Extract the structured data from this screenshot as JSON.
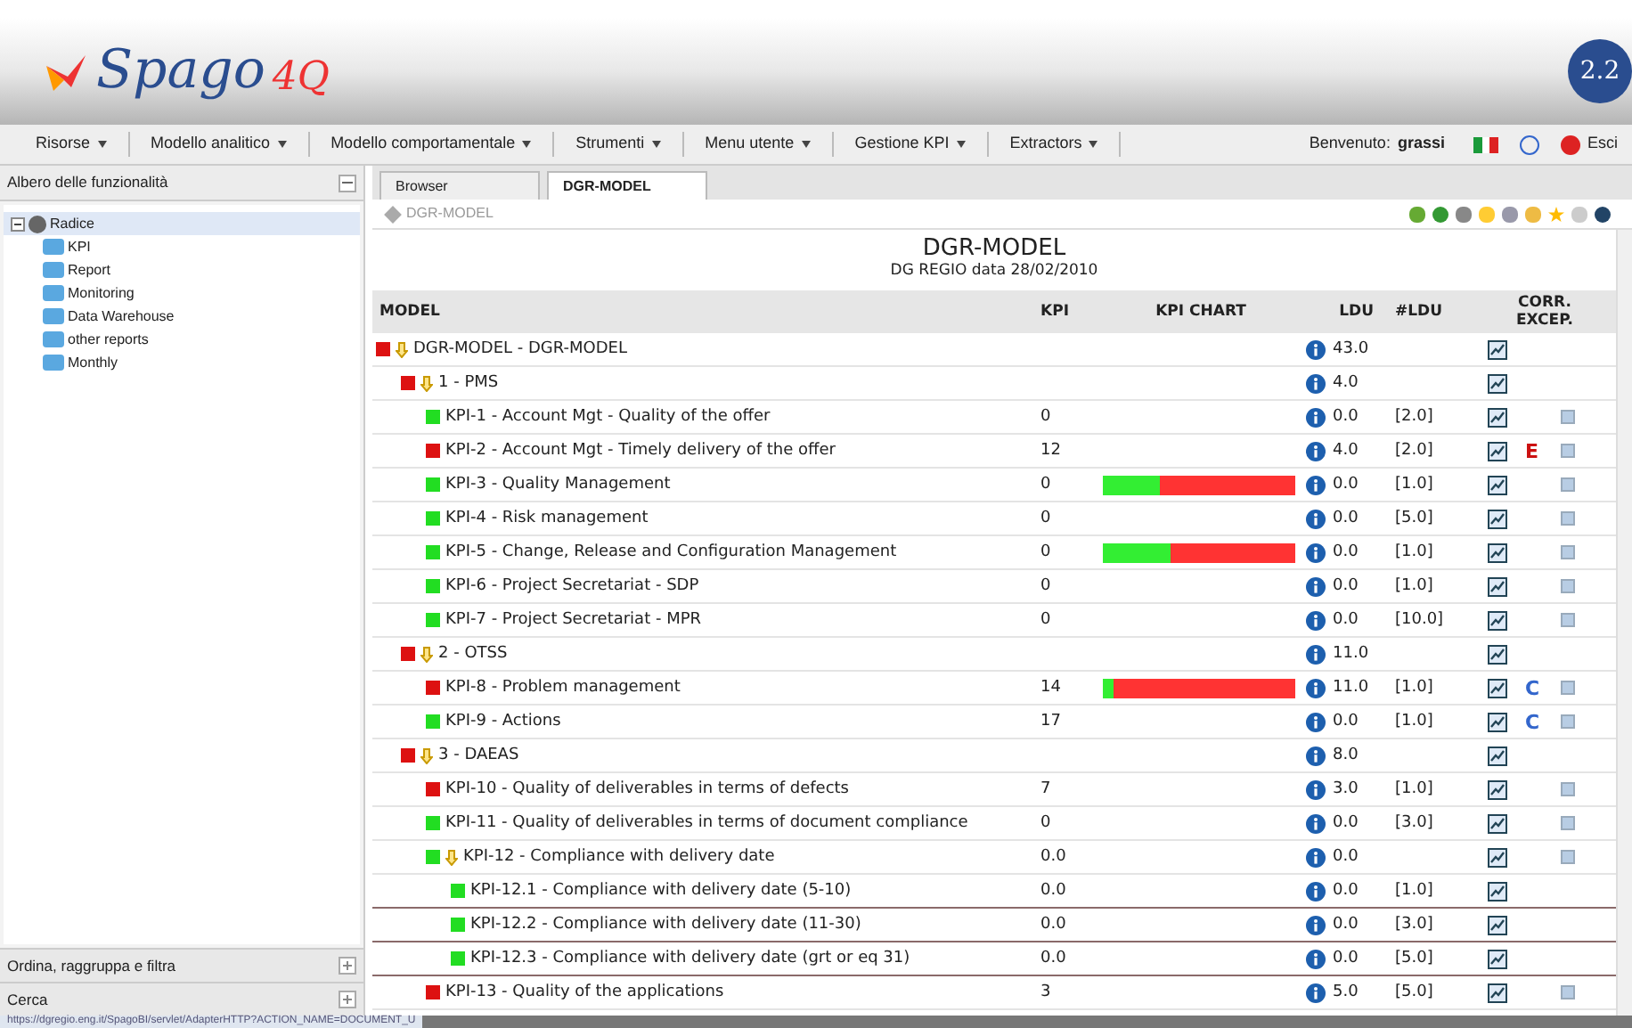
{
  "header": {
    "logo": "Spago",
    "logo_suffix": "4Q",
    "version": "2.2"
  },
  "menu": [
    {
      "label": "Risorse"
    },
    {
      "label": "Modello analitico"
    },
    {
      "label": "Modello comportamentale"
    },
    {
      "label": "Strumenti"
    },
    {
      "label": "Menu utente"
    },
    {
      "label": "Gestione KPI"
    },
    {
      "label": "Extractors"
    }
  ],
  "user": {
    "greeting": "Benvenuto:",
    "name": "grassi",
    "logout": "Esci"
  },
  "sidebar": {
    "title": "Albero delle funzionalità",
    "tree": [
      {
        "label": "Radice",
        "expanded": true,
        "children": [
          {
            "label": "KPI"
          },
          {
            "label": "Report"
          },
          {
            "label": "Monitoring"
          },
          {
            "label": "Data Warehouse"
          },
          {
            "label": "other reports"
          },
          {
            "label": "Monthly"
          }
        ]
      }
    ],
    "panels": [
      {
        "label": "Ordina, raggruppa e filtra"
      },
      {
        "label": "Cerca"
      }
    ]
  },
  "tabs": [
    {
      "label": "Browser",
      "selected": false
    },
    {
      "label": "DGR-MODEL",
      "selected": true
    }
  ],
  "breadcrumb": "DGR-MODEL",
  "report": {
    "title": "DGR-MODEL",
    "subtitle": "DG REGIO data 28/02/2010",
    "columns": [
      "MODEL",
      "KPI",
      "KPI CHART",
      "LDU",
      "#LDU",
      "CORR. EXCEP."
    ],
    "rows": [
      {
        "label": "DGR-MODEL - DGR-MODEL",
        "color": "#dd1111",
        "ldu": "43.0",
        "children": [
          {
            "label": "1 - PMS",
            "color": "#dd1111",
            "ldu": "4.0",
            "children": [
              {
                "label": "KPI-1 - Account Mgt - Quality of the offer",
                "color": "#22dd22",
                "kpi": "0",
                "ldu": "0.0",
                "weight": "[2.0]",
                "document": true
              },
              {
                "label": "KPI-2 - Account Mgt - Timely delivery of the offer",
                "color": "#dd1111",
                "kpi": "12",
                "ldu": "4.0",
                "weight": "[2.0]",
                "flag": {
                  "label": "E",
                  "color": "#cc1111"
                },
                "document": true
              },
              {
                "label": "KPI-3 - Quality Management",
                "color": "#22dd22",
                "kpi": "0",
                "chart": {
                  "level": 0.3
                },
                "ldu": "0.0",
                "weight": "[1.0]",
                "document": true
              },
              {
                "label": "KPI-4 - Risk management",
                "color": "#22dd22",
                "kpi": "0",
                "ldu": "0.0",
                "weight": "[5.0]",
                "document": true
              },
              {
                "label": "KPI-5 - Change, Release and Configuration Management",
                "color": "#22dd22",
                "kpi": "0",
                "chart": {
                  "level": 0.35
                },
                "ldu": "0.0",
                "weight": "[1.0]",
                "document": true
              },
              {
                "label": "KPI-6 - Project Secretariat - SDP",
                "color": "#22dd22",
                "kpi": "0",
                "ldu": "0.0",
                "weight": "[1.0]",
                "document": true
              },
              {
                "label": "KPI-7 - Project Secretariat - MPR",
                "color": "#22dd22",
                "kpi": "0",
                "ldu": "0.0",
                "weight": "[10.0]",
                "document": true
              }
            ]
          },
          {
            "label": "2 - OTSS",
            "color": "#dd1111",
            "ldu": "11.0",
            "children": [
              {
                "label": "KPI-8 - Problem management",
                "color": "#dd1111",
                "kpi": "14",
                "chart": {
                  "level": 0.06
                },
                "ldu": "11.0",
                "weight": "[1.0]",
                "flag": {
                  "label": "C",
                  "color": "#3366cc"
                },
                "document": true
              },
              {
                "label": "KPI-9 - Actions",
                "color": "#22dd22",
                "kpi": "17",
                "ldu": "0.0",
                "weight": "[1.0]",
                "flag": {
                  "label": "C",
                  "color": "#3366cc"
                },
                "document": true
              }
            ]
          },
          {
            "label": "3 - DAEAS",
            "color": "#dd1111",
            "ldu": "8.0",
            "children": [
              {
                "label": "KPI-10 - Quality of deliverables in terms of defects",
                "color": "#dd1111",
                "kpi": "7",
                "ldu": "3.0",
                "weight": "[1.0]",
                "document": true
              },
              {
                "label": "KPI-11 - Quality of deliverables in terms of document compliance",
                "color": "#22dd22",
                "kpi": "0",
                "ldu": "0.0",
                "weight": "[3.0]",
                "document": true
              },
              {
                "label": "KPI-12 - Compliance with delivery date",
                "color": "#22dd22",
                "kpi": "0.0",
                "ldu": "0.0",
                "document": true,
                "children": [
                  {
                    "label": "KPI-12.1 - Compliance with delivery date (5-10)",
                    "color": "#22dd22",
                    "kpi": "0.0",
                    "ldu": "0.0",
                    "weight": "[1.0]",
                    "document": false
                  },
                  {
                    "label": "KPI-12.2 - Compliance with delivery date (11-30)",
                    "color": "#22dd22",
                    "kpi": "0.0",
                    "ldu": "0.0",
                    "weight": "[3.0]",
                    "document": false
                  },
                  {
                    "label": "KPI-12.3 - Compliance with delivery date (grt or eq 31)",
                    "color": "#22dd22",
                    "kpi": "0.0",
                    "ldu": "0.0",
                    "weight": "[5.0]",
                    "document": false
                  }
                ]
              },
              {
                "label": "KPI-13 - Quality of the applications",
                "color": "#dd1111",
                "kpi": "3",
                "ldu": "5.0",
                "weight": "[5.0]",
                "document": true
              }
            ]
          }
        ]
      }
    ]
  },
  "status_bar": {
    "url": "https://dgregio.eng.it/SpagoBI/servlet/AdapterHTTP?ACTION_NAME=DOCUMENT_U"
  }
}
